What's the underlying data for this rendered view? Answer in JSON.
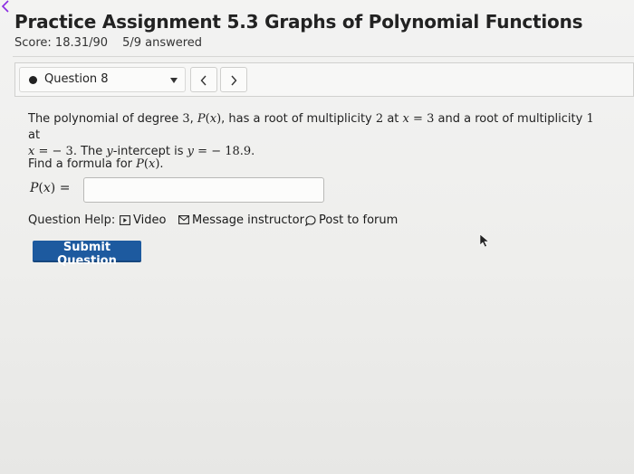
{
  "header": {
    "title": "Practice Assignment 5.3 Graphs of Polynomial Functions",
    "score": "Score: 18.31/90",
    "answered": "5/9 answered"
  },
  "question_nav": {
    "selected": "Question 8",
    "icons": {
      "status": "filled-dot-icon",
      "dropdown": "caret-down-icon",
      "prev": "chevron-left-icon",
      "next": "chevron-right-icon"
    }
  },
  "question": {
    "line1_a": "The polynomial of degree",
    "degree": "3",
    "poly_fn": "P",
    "poly_var": "x",
    "line1_b": ", has a root of multiplicity",
    "mult1": "2",
    "line1_c": "at",
    "root_var": "x",
    "root1": "3",
    "line1_d": "and a root of multiplicity",
    "mult2": "1",
    "line1_e": "at",
    "root2_var": "x",
    "root2": "− 3",
    "line2_a": ". The",
    "yvar": "y",
    "line2_b": "-intercept is",
    "yvar2": "y",
    "yintercept": "− 18.9",
    "line2_end": "."
  },
  "find": {
    "prefix": "Find a formula for",
    "fn": "P",
    "var": "x",
    "suffix": "."
  },
  "answer": {
    "fn": "P",
    "var": "x",
    "value": "",
    "placeholder": ""
  },
  "help": {
    "label": "Question Help:",
    "video": "Video",
    "message": "Message instructor",
    "forum": "Post to forum",
    "icons": {
      "video": "video-icon",
      "message": "envelope-icon",
      "forum": "speech-bubble-icon"
    }
  },
  "submit_label": "Submit Question",
  "colors": {
    "submit_bg": "#1d5a9f",
    "page_bg": "#efefed"
  }
}
